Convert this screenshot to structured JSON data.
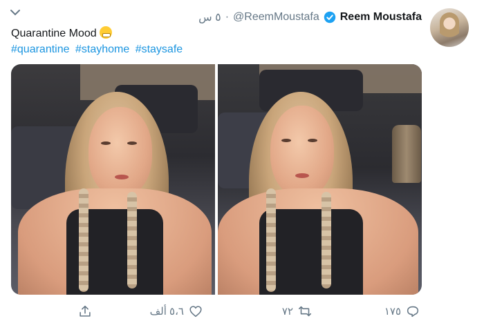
{
  "tweet": {
    "author_name": "Reem Moustafa",
    "handle": "@ReemMoustafa",
    "separator": "·",
    "time": "٥ س",
    "text": "Quarantine Mood",
    "hashtags": [
      "#quarantine",
      "#stayhome",
      "#staysafe"
    ]
  },
  "actions": {
    "reply_count": "١٧٥",
    "retweet_count": "٧٢",
    "like_count": "٥،٦ ألف"
  },
  "icons": {
    "menu": "chevron-down-icon",
    "verified": "verified-badge-icon",
    "reply": "reply-icon",
    "retweet": "retweet-icon",
    "like": "heart-icon",
    "share": "share-icon"
  },
  "colors": {
    "link": "#1b95e0",
    "muted": "#657786",
    "text": "#14171a",
    "verified": "#1da1f2"
  }
}
